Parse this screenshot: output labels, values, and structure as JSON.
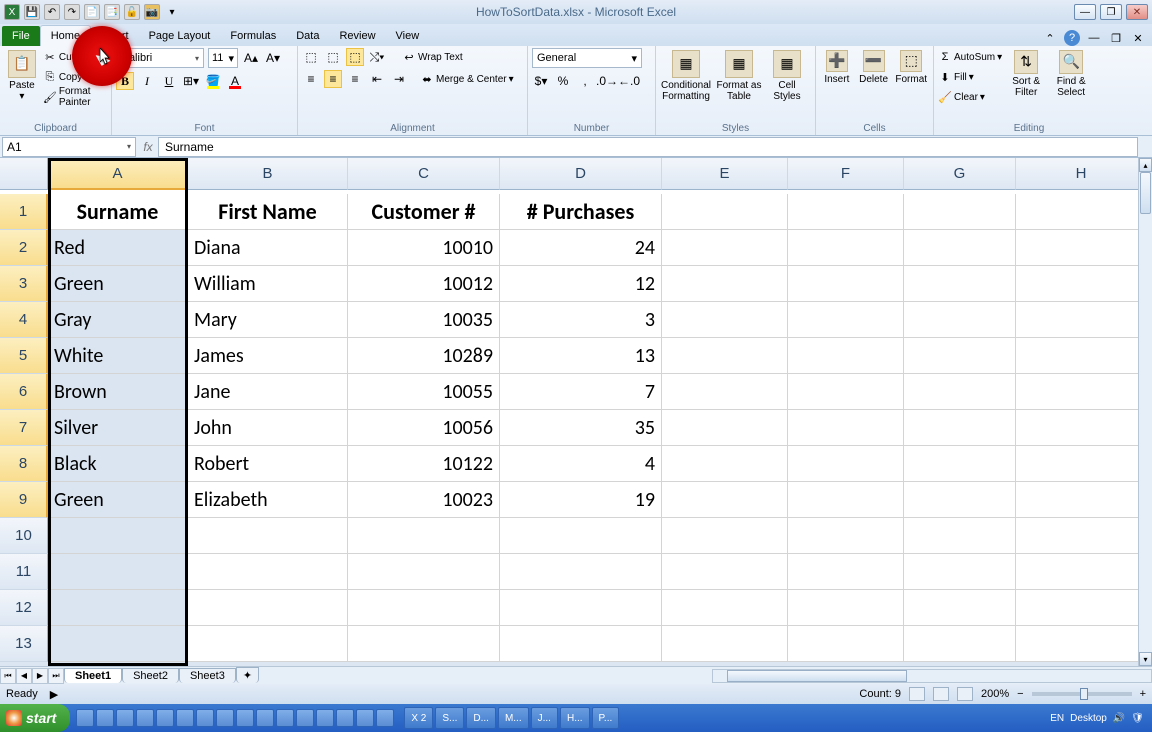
{
  "title": {
    "filename": "HowToSortData.xlsx",
    "app": "Microsoft Excel"
  },
  "tabs": {
    "file": "File",
    "home": "Home",
    "insert": "Insert",
    "pagelayout": "Page Layout",
    "formulas": "Formulas",
    "data": "Data",
    "review": "Review",
    "view": "View"
  },
  "ribbon": {
    "clipboard": {
      "paste": "Paste",
      "cut": "Cut",
      "copy": "Copy",
      "fp": "Format Painter",
      "label": "Clipboard"
    },
    "font": {
      "name": "Calibri",
      "size": "11",
      "label": "Font"
    },
    "alignment": {
      "wrap": "Wrap Text",
      "merge": "Merge & Center",
      "label": "Alignment"
    },
    "number": {
      "format": "General",
      "label": "Number"
    },
    "styles": {
      "cond": "Conditional Formatting",
      "ftable": "Format as Table",
      "cstyles": "Cell Styles",
      "label": "Styles"
    },
    "cells": {
      "insert": "Insert",
      "delete": "Delete",
      "format": "Format",
      "label": "Cells"
    },
    "editing": {
      "autosum": "AutoSum",
      "fill": "Fill",
      "clear": "Clear",
      "sort": "Sort & Filter",
      "find": "Find & Select",
      "label": "Editing"
    }
  },
  "namebox": "A1",
  "formula": "Surname",
  "columns": [
    "A",
    "B",
    "C",
    "D",
    "E",
    "F",
    "G",
    "H"
  ],
  "row_labels": [
    "1",
    "2",
    "3",
    "4",
    "5",
    "6",
    "7",
    "8",
    "9",
    "10",
    "11",
    "12",
    "13"
  ],
  "table_data": {
    "headers": [
      "Surname",
      "First Name",
      "Customer #",
      "# Purchases"
    ],
    "rows": [
      [
        "Red",
        "Diana",
        "10010",
        "24"
      ],
      [
        "Green",
        "William",
        "10012",
        "12"
      ],
      [
        "Gray",
        "Mary",
        "10035",
        "3"
      ],
      [
        "White",
        "James",
        "10289",
        "13"
      ],
      [
        "Brown",
        "Jane",
        "10055",
        "7"
      ],
      [
        "Silver",
        "John",
        "10056",
        "35"
      ],
      [
        "Black",
        "Robert",
        "10122",
        "4"
      ],
      [
        "Green",
        "Elizabeth",
        "10023",
        "19"
      ]
    ]
  },
  "sheets": [
    "Sheet1",
    "Sheet2",
    "Sheet3"
  ],
  "status": {
    "ready": "Ready",
    "count": "Count: 9",
    "zoom": "200%"
  },
  "taskbar": {
    "start": "start",
    "lang": "EN",
    "desktop": "Desktop",
    "tasks": [
      "X 2",
      "S...",
      "D...",
      "M...",
      "J...",
      "H...",
      "P..."
    ]
  }
}
